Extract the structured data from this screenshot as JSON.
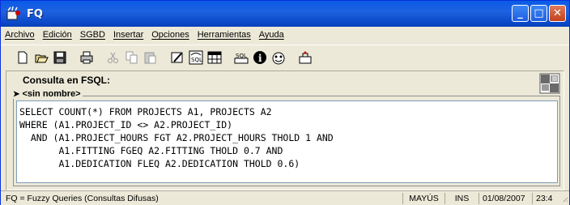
{
  "window": {
    "title": "FQ"
  },
  "menu": [
    "Archivo",
    "Edición",
    "SGBD",
    "Insertar",
    "Opciones",
    "Herramientas",
    "Ayuda"
  ],
  "toolbar": {
    "buttons": [
      "new-icon",
      "open-icon",
      "save-icon",
      "print-icon",
      "cut-icon",
      "copy-icon",
      "paste-icon",
      "clear-icon",
      "fsql-icon",
      "table-icon",
      "sql-icon",
      "info-icon",
      "exit-icon",
      "run-icon"
    ]
  },
  "panel": {
    "label": "Consulta en FSQL:",
    "query_name": "<sin nombre>",
    "query": "SELECT COUNT(*) FROM PROJECTS A1, PROJECTS A2\nWHERE (A1.PROJECT_ID <> A2.PROJECT_ID)\n  AND (A1.PROJECT_HOURS FGT A2.PROJECT_HOURS THOLD 1 AND\n       A1.FITTING FGEQ A2.FITTING THOLD 0.7 AND\n       A1.DEDICATION FLEQ A2.DEDICATION THOLD 0.6)"
  },
  "status": {
    "description": "FQ = Fuzzy Queries (Consultas Difusas)",
    "caps": "MAYÚS",
    "ins": "INS",
    "date": "01/08/2007",
    "time": "23:4"
  }
}
